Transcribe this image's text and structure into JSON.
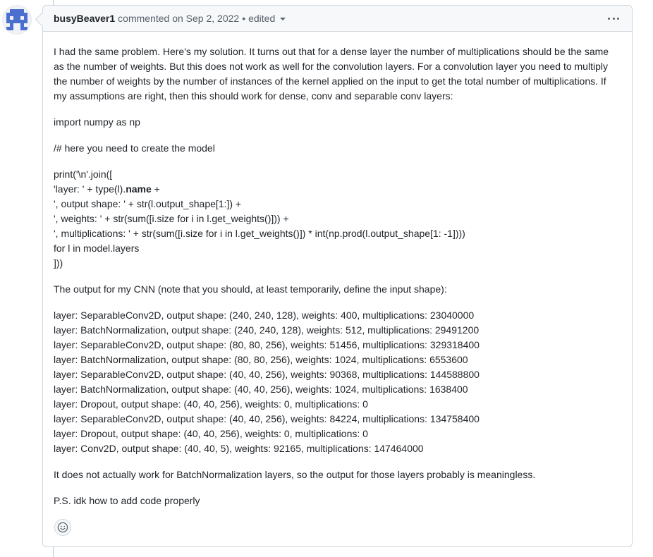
{
  "comment": {
    "author": "busyBeaver1",
    "action": "commented on Sep 2, 2022",
    "separator": "•",
    "edited_label": "edited",
    "avatar_icon": "identicon-avatar",
    "menu_icon": "kebab-horizontal-icon",
    "reaction_icon": "smiley-icon",
    "paragraph1": "I had the same problem. Here's my solution. It turns out that for a dense layer the number of multiplications should be the same as the number of weights. But this does not work as well for the convolution layers. For a convolution layer you need to multiply the number of weights by the number of instances of the kernel applied on the input to get the total number of multiplications. If my assumptions are right, then this should work for dense, conv and separable conv layers:",
    "import_line": "import numpy as np",
    "comment_line": "/# here you need to create the model",
    "code": {
      "l1": "print('\\n'.join([",
      "l2_pre": "'layer: ' + type(l).",
      "l2_bold": "name",
      "l2_post": " +",
      "l3": "', output shape: ' + str(l.output_shape[1:]) +",
      "l4": "', weights: ' + str(sum([i.size for i in l.get_weights()])) +",
      "l5": "', multiplications: ' + str(sum([i.size for i in l.get_weights()]) * int(np.prod(l.output_shape[1: -1])))",
      "l6": "for l in model.layers",
      "l7": "]))"
    },
    "output_intro": "The output for my CNN (note that you should, at least temporarily, define the input shape):",
    "output_lines": [
      "layer: SeparableConv2D, output shape: (240, 240, 128), weights: 400, multiplications: 23040000",
      "layer: BatchNormalization, output shape: (240, 240, 128), weights: 512, multiplications: 29491200",
      "layer: SeparableConv2D, output shape: (80, 80, 256), weights: 51456, multiplications: 329318400",
      "layer: BatchNormalization, output shape: (80, 80, 256), weights: 1024, multiplications: 6553600",
      "layer: SeparableConv2D, output shape: (40, 40, 256), weights: 90368, multiplications: 144588800",
      "layer: BatchNormalization, output shape: (40, 40, 256), weights: 1024, multiplications: 1638400",
      "layer: Dropout, output shape: (40, 40, 256), weights: 0, multiplications: 0",
      "layer: SeparableConv2D, output shape: (40, 40, 256), weights: 84224, multiplications: 134758400",
      "layer: Dropout, output shape: (40, 40, 256), weights: 0, multiplications: 0",
      "layer: Conv2D, output shape: (40, 40, 5), weights: 92165, multiplications: 147464000"
    ],
    "closing1": "It does not actually work for BatchNormalization layers, so the output for those layers probably is meaningless.",
    "closing2": "P.S. idk how to add code properly"
  },
  "colors": {
    "avatar": "#4a6fcf",
    "border": "#d0d7de",
    "header_bg": "#f6f8fa",
    "text": "#1f2328",
    "muted": "#57606a"
  }
}
